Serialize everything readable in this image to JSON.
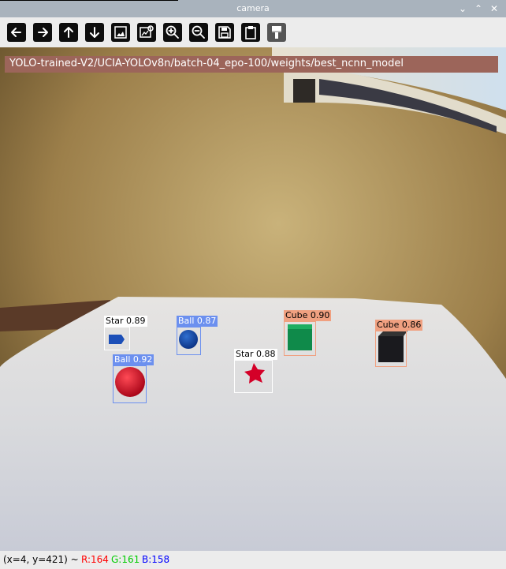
{
  "window": {
    "title": "camera"
  },
  "title_controls": {
    "minimize": "⌄",
    "maximize": "⌃",
    "close": "✕"
  },
  "toolbar": {
    "buttons": [
      {
        "icon": "arrow-left-icon"
      },
      {
        "icon": "arrow-right-icon"
      },
      {
        "icon": "arrow-up-icon"
      },
      {
        "icon": "arrow-down-icon"
      },
      {
        "icon": "image-icon"
      },
      {
        "icon": "image-settings-icon"
      },
      {
        "icon": "zoom-in-icon"
      },
      {
        "icon": "zoom-out-icon"
      },
      {
        "icon": "save-icon"
      },
      {
        "icon": "clipboard-icon"
      },
      {
        "icon": "properties-icon"
      }
    ]
  },
  "overlay": {
    "model_path": "YOLO-trained-V2/UCIA-YOLOv8n/batch-04_epo-100/weights/best_ncnn_model"
  },
  "detections": [
    {
      "label": "Star 0.89",
      "class": "star"
    },
    {
      "label": "Ball 0.87",
      "class": "ball"
    },
    {
      "label": "Cube 0.90",
      "class": "cube"
    },
    {
      "label": "Cube 0.86",
      "class": "cube"
    },
    {
      "label": "Star 0.88",
      "class": "star"
    },
    {
      "label": "Ball 0.92",
      "class": "ball"
    }
  ],
  "status": {
    "coords": "(x=4, y=421) ~",
    "r": "R:164",
    "g": "G:161",
    "b": "B:158",
    "colors": {
      "r": "#ff0000",
      "g": "#00cc00",
      "b": "#0000ff"
    }
  }
}
